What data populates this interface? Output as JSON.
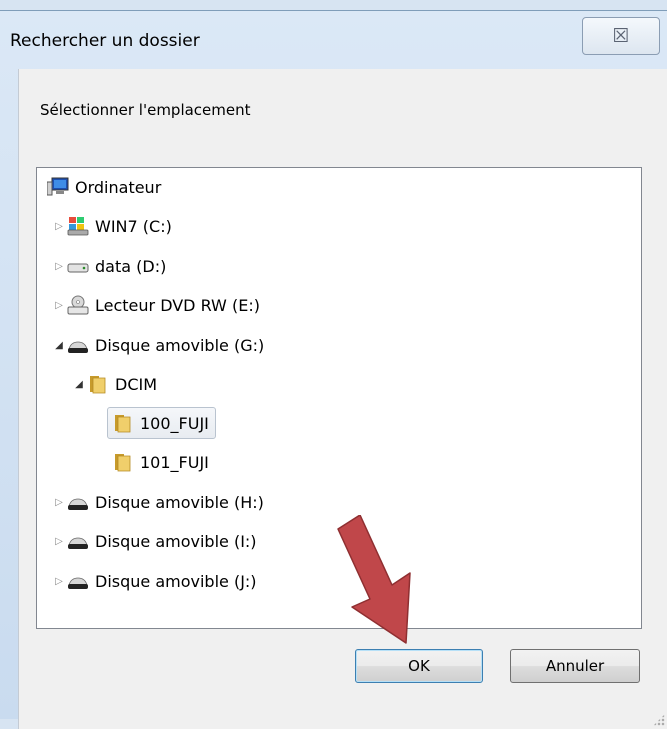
{
  "window": {
    "title": "Rechercher un dossier",
    "close_glyph": "☒"
  },
  "dialog": {
    "instruction": "Sélectionner l'emplacement"
  },
  "tree": {
    "items": [
      {
        "label": "Ordinateur",
        "icon": "computer-icon",
        "expander": "",
        "depth": 0
      },
      {
        "label": "WIN7 (C:)",
        "icon": "windows-drive-icon",
        "expander": "▷",
        "depth": 1
      },
      {
        "label": "data (D:)",
        "icon": "hard-drive-icon",
        "expander": "▷",
        "depth": 1
      },
      {
        "label": "Lecteur DVD RW (E:)",
        "icon": "dvd-drive-icon",
        "expander": "▷",
        "depth": 1
      },
      {
        "label": "Disque amovible (G:)",
        "icon": "removable-drive-icon",
        "expander": "◢",
        "depth": 1
      },
      {
        "label": "DCIM",
        "icon": "folder-icon",
        "expander": "◢",
        "depth": 2
      },
      {
        "label": "100_FUJI",
        "icon": "folder-icon",
        "expander": "",
        "depth": 3,
        "selected": true
      },
      {
        "label": "101_FUJI",
        "icon": "folder-icon",
        "expander": "",
        "depth": 3
      },
      {
        "label": "Disque amovible (H:)",
        "icon": "removable-drive-icon",
        "expander": "▷",
        "depth": 1
      },
      {
        "label": "Disque amovible (I:)",
        "icon": "removable-drive-icon",
        "expander": "▷",
        "depth": 1
      },
      {
        "label": "Disque amovible (J:)",
        "icon": "removable-drive-icon",
        "expander": "▷",
        "depth": 1
      }
    ]
  },
  "buttons": {
    "ok": "OK",
    "cancel": "Annuler"
  },
  "colors": {
    "annotation_arrow": "#c0474a",
    "folder": "#e8c15a",
    "selection_border": "#b9c3cf"
  }
}
